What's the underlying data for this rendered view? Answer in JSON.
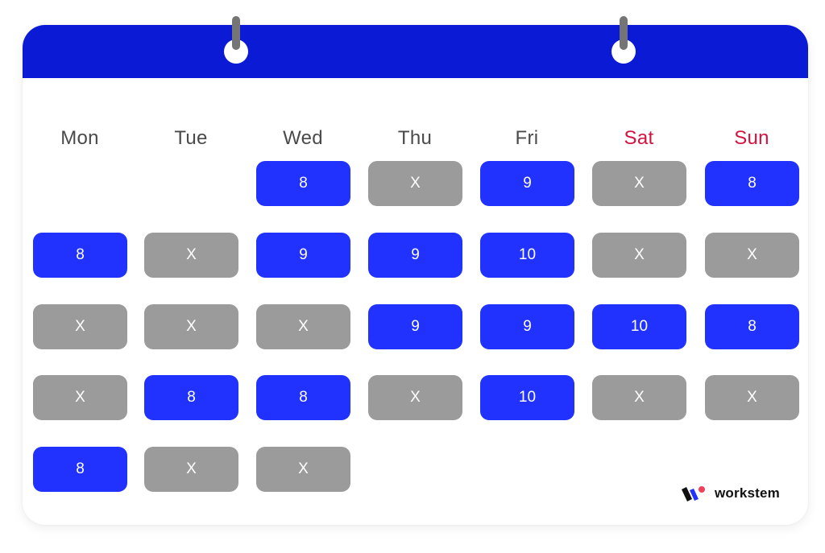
{
  "calendar": {
    "weekdays": [
      "Mon",
      "Tue",
      "Wed",
      "Thu",
      "Fri",
      "Sat",
      "Sun"
    ],
    "weekend_days": [
      "Sat",
      "Sun"
    ],
    "colors": {
      "header": "#0b1ad4",
      "work_cell": "#2132ff",
      "off_cell": "#9b9b9b",
      "weekday_text": "#4a4a4a",
      "weekend_text": "#d4123f"
    },
    "rows": [
      [
        null,
        null,
        "8",
        "X",
        "9",
        "X",
        "8"
      ],
      [
        "8",
        "X",
        "9",
        "9",
        "10",
        "X",
        "X"
      ],
      [
        "X",
        "X",
        "X",
        "9",
        "9",
        "10",
        "8"
      ],
      [
        "X",
        "8",
        "8",
        "X",
        "10",
        "X",
        "X"
      ],
      [
        "8",
        "X",
        "X",
        null,
        null,
        null,
        null
      ]
    ]
  },
  "brand": {
    "name": "workstem",
    "icon": "workstem-logo-icon"
  }
}
